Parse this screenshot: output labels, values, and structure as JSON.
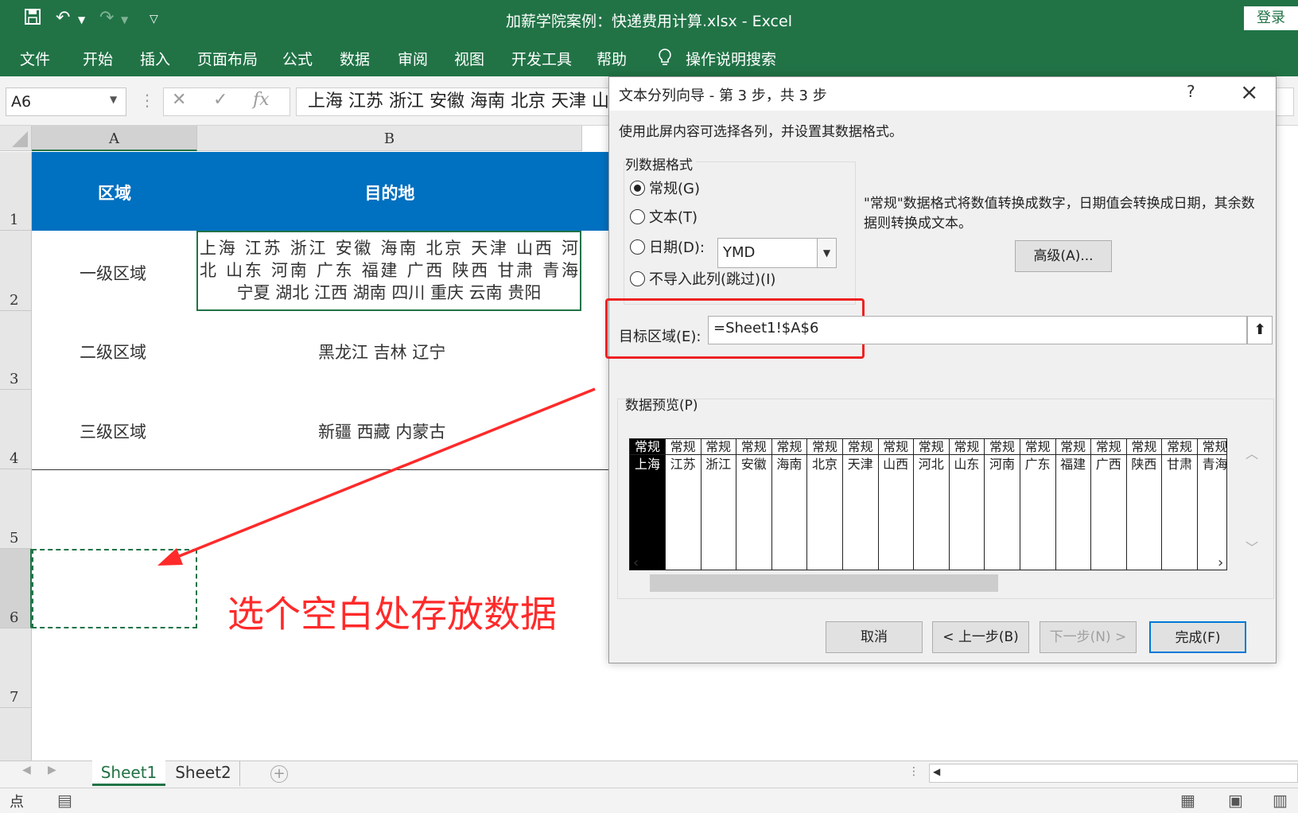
{
  "titlebar": {
    "title": "加薪学院案例：快递费用计算.xlsx  -  Excel",
    "login": "登录",
    "quick_access": {
      "save_icon": "save-icon",
      "undo_icon": "undo-icon",
      "redo_icon": "redo-icon",
      "customize_icon": "customize-icon"
    }
  },
  "ribbon": {
    "tabs": [
      "文件",
      "开始",
      "插入",
      "页面布局",
      "公式",
      "数据",
      "审阅",
      "视图",
      "开发工具",
      "帮助"
    ],
    "search": "操作说明搜索"
  },
  "formula_bar": {
    "name_box": "A6",
    "fx": "fx",
    "content": "上海 江苏 浙江 安徽 海南 北京 天津 山西"
  },
  "grid": {
    "columns": [
      "A",
      "B"
    ],
    "rows": [
      "1",
      "2",
      "3",
      "4",
      "5",
      "6",
      "7"
    ],
    "header": {
      "a1": "区域",
      "b1": "目的地"
    },
    "cells": {
      "a2": "一级区域",
      "b2_line1": "上海 江苏 浙江 安徽 海南 北京 天津 山西 河",
      "b2_line2": "北 山东 河南 广东 福建 广西 陕西 甘肃 青海",
      "b2_line3": "宁夏 湖北 江西 湖南 四川 重庆 云南 贵阳",
      "a3": "二级区域",
      "b3": "黑龙江  吉林  辽宁",
      "a4": "三级区域",
      "b4": "新疆  西藏  内蒙古"
    },
    "annotation": "选个空白处存放数据",
    "annotation_color": "#ff2a2a",
    "header_fill": "#0070c0"
  },
  "sheet_tabs": [
    "Sheet1",
    "Sheet2"
  ],
  "status": {
    "mode": "点"
  },
  "dialog": {
    "title": "文本分列向导 - 第 3 步，共 3 步",
    "help": "?",
    "intro": "使用此屏内容可选择各列，并设置其数据格式。",
    "format_group": "列数据格式",
    "radio_general": "常规(G)",
    "radio_text": "文本(T)",
    "radio_date": "日期(D):",
    "radio_skip": "不导入此列(跳过)(I)",
    "date_format": "YMD",
    "description": "\"常规\"数据格式将数值转换成数字，日期值会转换成日期，其余数据则转换成文本。",
    "advanced_button": "高级(A)...",
    "destination_label": "目标区域(E):",
    "destination_value": "=Sheet1!$A$6",
    "preview_label": "数据预览(P)",
    "preview_columns": [
      {
        "header": "常规",
        "value": "上海"
      },
      {
        "header": "常规",
        "value": "江苏"
      },
      {
        "header": "常规",
        "value": "浙江"
      },
      {
        "header": "常规",
        "value": "安徽"
      },
      {
        "header": "常规",
        "value": "海南"
      },
      {
        "header": "常规",
        "value": "北京"
      },
      {
        "header": "常规",
        "value": "天津"
      },
      {
        "header": "常规",
        "value": "山西"
      },
      {
        "header": "常规",
        "value": "河北"
      },
      {
        "header": "常规",
        "value": "山东"
      },
      {
        "header": "常规",
        "value": "河南"
      },
      {
        "header": "常规",
        "value": "广东"
      },
      {
        "header": "常规",
        "value": "福建"
      },
      {
        "header": "常规",
        "value": "广西"
      },
      {
        "header": "常规",
        "value": "陕西"
      },
      {
        "header": "常规",
        "value": "甘肃"
      },
      {
        "header": "常规",
        "value": "青海"
      }
    ],
    "buttons": {
      "cancel": "取消",
      "back": "< 上一步(B)",
      "next": "下一步(N) >",
      "finish": "完成(F)"
    },
    "accent_color": "#0078d7",
    "highlight_color": "#ee2222"
  },
  "colors": {
    "excel_green": "#217346"
  }
}
